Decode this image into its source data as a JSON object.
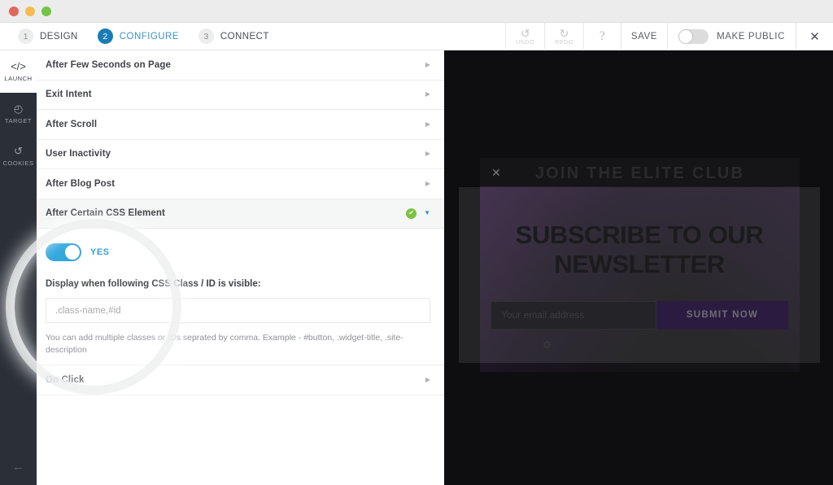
{
  "window": {
    "traffic_lights": [
      "close",
      "minimize",
      "maximize"
    ]
  },
  "steps": [
    {
      "num": "1",
      "label": "DESIGN",
      "active": false
    },
    {
      "num": "2",
      "label": "CONFIGURE",
      "active": true
    },
    {
      "num": "3",
      "label": "CONNECT",
      "active": false
    }
  ],
  "toolbar": {
    "undo_icon": "↺",
    "undo_label": "UNDO",
    "redo_icon": "↻",
    "redo_label": "REDO",
    "help_label": "?",
    "save_label": "SAVE",
    "make_public_label": "MAKE PUBLIC",
    "make_public_on": false,
    "close_label": "✕"
  },
  "sidebar": {
    "items": [
      {
        "icon": "</>",
        "label": "LAUNCH",
        "active": true
      },
      {
        "icon": "◴",
        "label": "TARGET",
        "active": false
      },
      {
        "icon": "↺",
        "label": "COOKIES",
        "active": false
      }
    ],
    "back_icon": "←"
  },
  "panel": {
    "rows": [
      {
        "title": "After Few Seconds on Page",
        "caret": "▶"
      },
      {
        "title": "Exit Intent",
        "caret": "▶"
      },
      {
        "title": "After Scroll",
        "caret": "▶"
      },
      {
        "title": "User Inactivity",
        "caret": "▶"
      },
      {
        "title": "After Blog Post",
        "caret": "▶"
      }
    ],
    "open_row": {
      "title": "After Certain CSS Element",
      "check_icon": "✔",
      "caret": "▼"
    },
    "body": {
      "toggle_state_label": "YES",
      "toggle_on": true,
      "field_label": "Display when following CSS Class / ID is visible:",
      "input_value": "",
      "input_placeholder": ".class-name,#id",
      "helper_text": "You can add multiple classes or IDs seprated by comma. Example - #button, .widget-title, .site-description"
    },
    "last_row": {
      "title": "On Click",
      "caret": "▶"
    }
  },
  "preview": {
    "banner_title": "JOIN THE ELITE CLUB",
    "banner_close": "✕",
    "modal_title": "SUBSCRIBE TO OUR NEWSLETTER",
    "email_placeholder": "Your email address",
    "submit_label": "SUBMIT NOW",
    "foot_icon": "⚙"
  },
  "colors": {
    "accent_blue": "#1b7cb5",
    "toggle_blue": "#27a3dd",
    "check_green": "#7cc242",
    "sidebar_dark": "#2b3038",
    "submit_purple": "#2b1b40"
  }
}
